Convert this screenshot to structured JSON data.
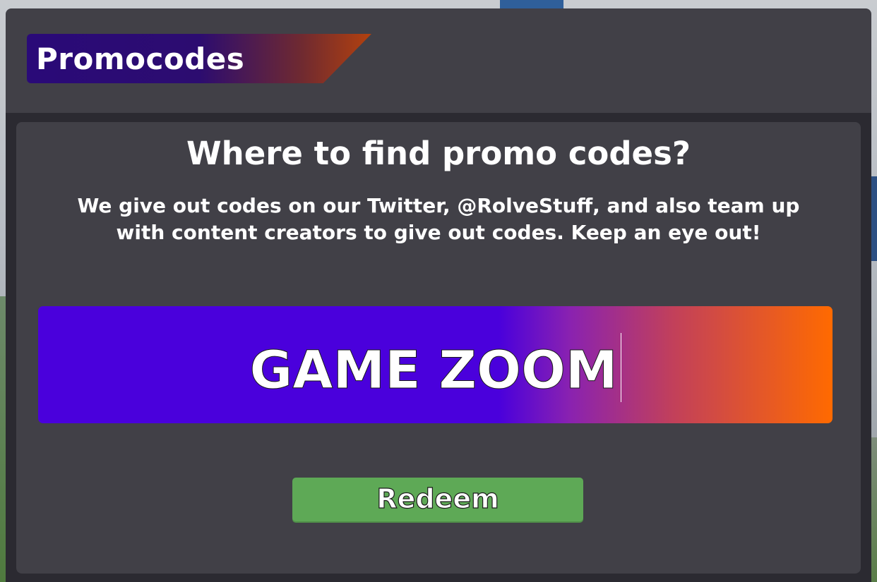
{
  "window": {
    "title": "Promocodes"
  },
  "content": {
    "heading": "Where to find promo codes?",
    "description": "We give out codes on our Twitter, @RolveStuff, and also team up with content creators to give out codes. Keep an eye out!"
  },
  "code_input": {
    "value": "GAME ZOOM"
  },
  "redeem_button": {
    "label": "Redeem"
  },
  "colors": {
    "panel": "#414047",
    "frame": "#2b2a31",
    "input_gradient_start": "#4a00dc",
    "input_gradient_end": "#ff6a00",
    "button": "#5ea956",
    "text": "#ffffff"
  }
}
